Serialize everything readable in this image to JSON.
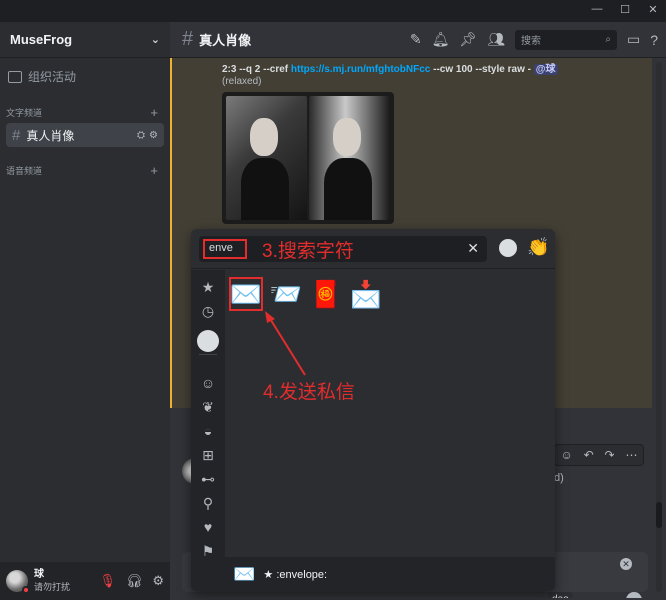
{
  "window": {
    "controls": [
      "—",
      "☐",
      "✕"
    ]
  },
  "sidebar": {
    "guild_name": "MuseFrog",
    "org_item": "组织活动",
    "text_category": "文字频道",
    "voice_category": "语音频道",
    "active_channel": "真人肖像"
  },
  "user": {
    "name": "球",
    "status": "请勿打扰"
  },
  "channel": {
    "title": "真人肖像",
    "search_placeholder": "搜索"
  },
  "message": {
    "cmd_prefix": "2:3 --q 2 --cref ",
    "cmd_link": "https://s.mj.run/mfghtobNFcc",
    "cmd_suffix": " --cw 100 --style raw - ",
    "mention": "@球",
    "status": "(relaxed)",
    "partial_text": "d)",
    "video_chip": "deo"
  },
  "emoji_picker": {
    "search_value": "enve",
    "annotation_search": "3.搜索字符",
    "annotation_send": "4.发送私信",
    "results": [
      "✉️",
      "📨",
      "🧧",
      "📩"
    ],
    "footer_emoji": "✉️",
    "footer_label": "★ :envelope:"
  },
  "colors": {
    "accent_red": "#e32d2d",
    "link": "#00a8fc",
    "highlight": "#433f35"
  }
}
